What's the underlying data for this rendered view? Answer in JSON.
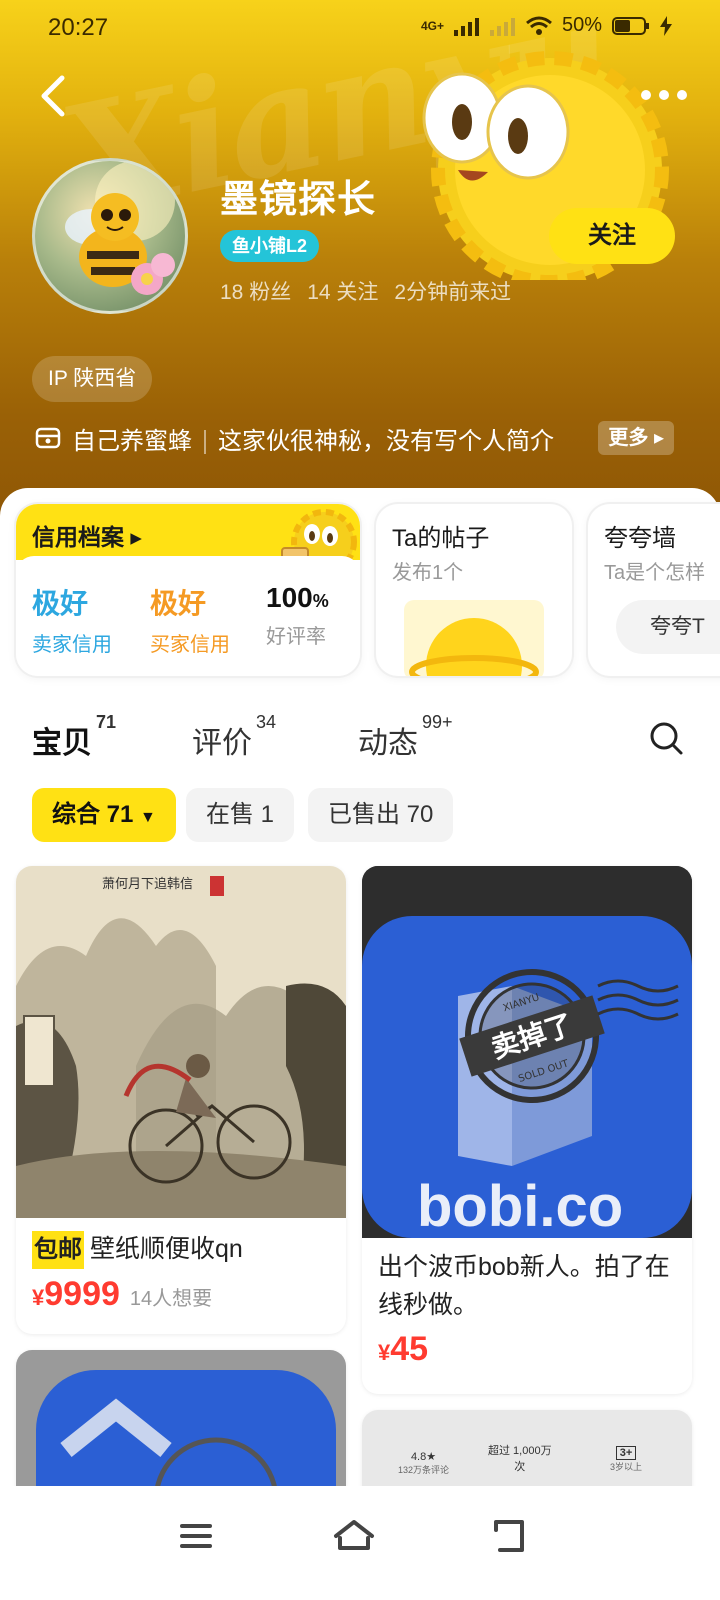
{
  "status_bar": {
    "time": "20:27",
    "network": "4G+",
    "battery": "50%"
  },
  "profile": {
    "name": "墨镜探长",
    "badge": "鱼小铺L2",
    "fans": "18 粉丝",
    "following": "14 关注",
    "last_seen": "2分钟前来过",
    "follow_label": "关注",
    "ip": "IP 陕西省",
    "bio_tag": "自己养蜜蜂",
    "bio_text": "这家伙很神秘，没有写个人简介",
    "more_label": "更多"
  },
  "cards": {
    "credit": {
      "title": "信用档案",
      "seller_value": "极好",
      "seller_label": "卖家信用",
      "buyer_value": "极好",
      "buyer_label": "买家信用",
      "rate_value": "100",
      "rate_unit": "%",
      "rate_label": "好评率"
    },
    "posts": {
      "title": "Ta的帖子",
      "sub": "发布1个"
    },
    "praise": {
      "title": "夸夸墙",
      "sub": "Ta是个怎样",
      "button": "夸夸T"
    }
  },
  "tabs": [
    {
      "label": "宝贝",
      "count": "71"
    },
    {
      "label": "评价",
      "count": "34"
    },
    {
      "label": "动态",
      "count": "99+"
    }
  ],
  "filters": [
    {
      "label": "综合 71"
    },
    {
      "label": "在售 1"
    },
    {
      "label": "已售出 70"
    }
  ],
  "products": [
    {
      "tag": "包邮",
      "title": "壁纸顺便收qn",
      "yen": "¥",
      "price": "9999",
      "want": "14人想要",
      "painting_text": "萧何月下追韩信"
    },
    {
      "title": "出个波币bob新人。拍了在线秒做。",
      "yen": "¥",
      "price": "45",
      "image_text": "bobi.co",
      "stamp_top": "XIANYU",
      "stamp_main": "卖掉了",
      "stamp_bottom": "SOLD OUT"
    }
  ],
  "partial_product": {
    "rating": "4.8★",
    "reviews": "132万条评论",
    "downloads": "超过 1,000万",
    "downloads_unit": "次",
    "age": "3+",
    "age_label": "3岁以上"
  },
  "colors": {
    "accent_yellow": "#ffe114",
    "price_red": "#ff3b30",
    "seller_blue": "#2da7e0",
    "buyer_orange": "#f59a23",
    "badge_teal": "#24c4d8"
  }
}
